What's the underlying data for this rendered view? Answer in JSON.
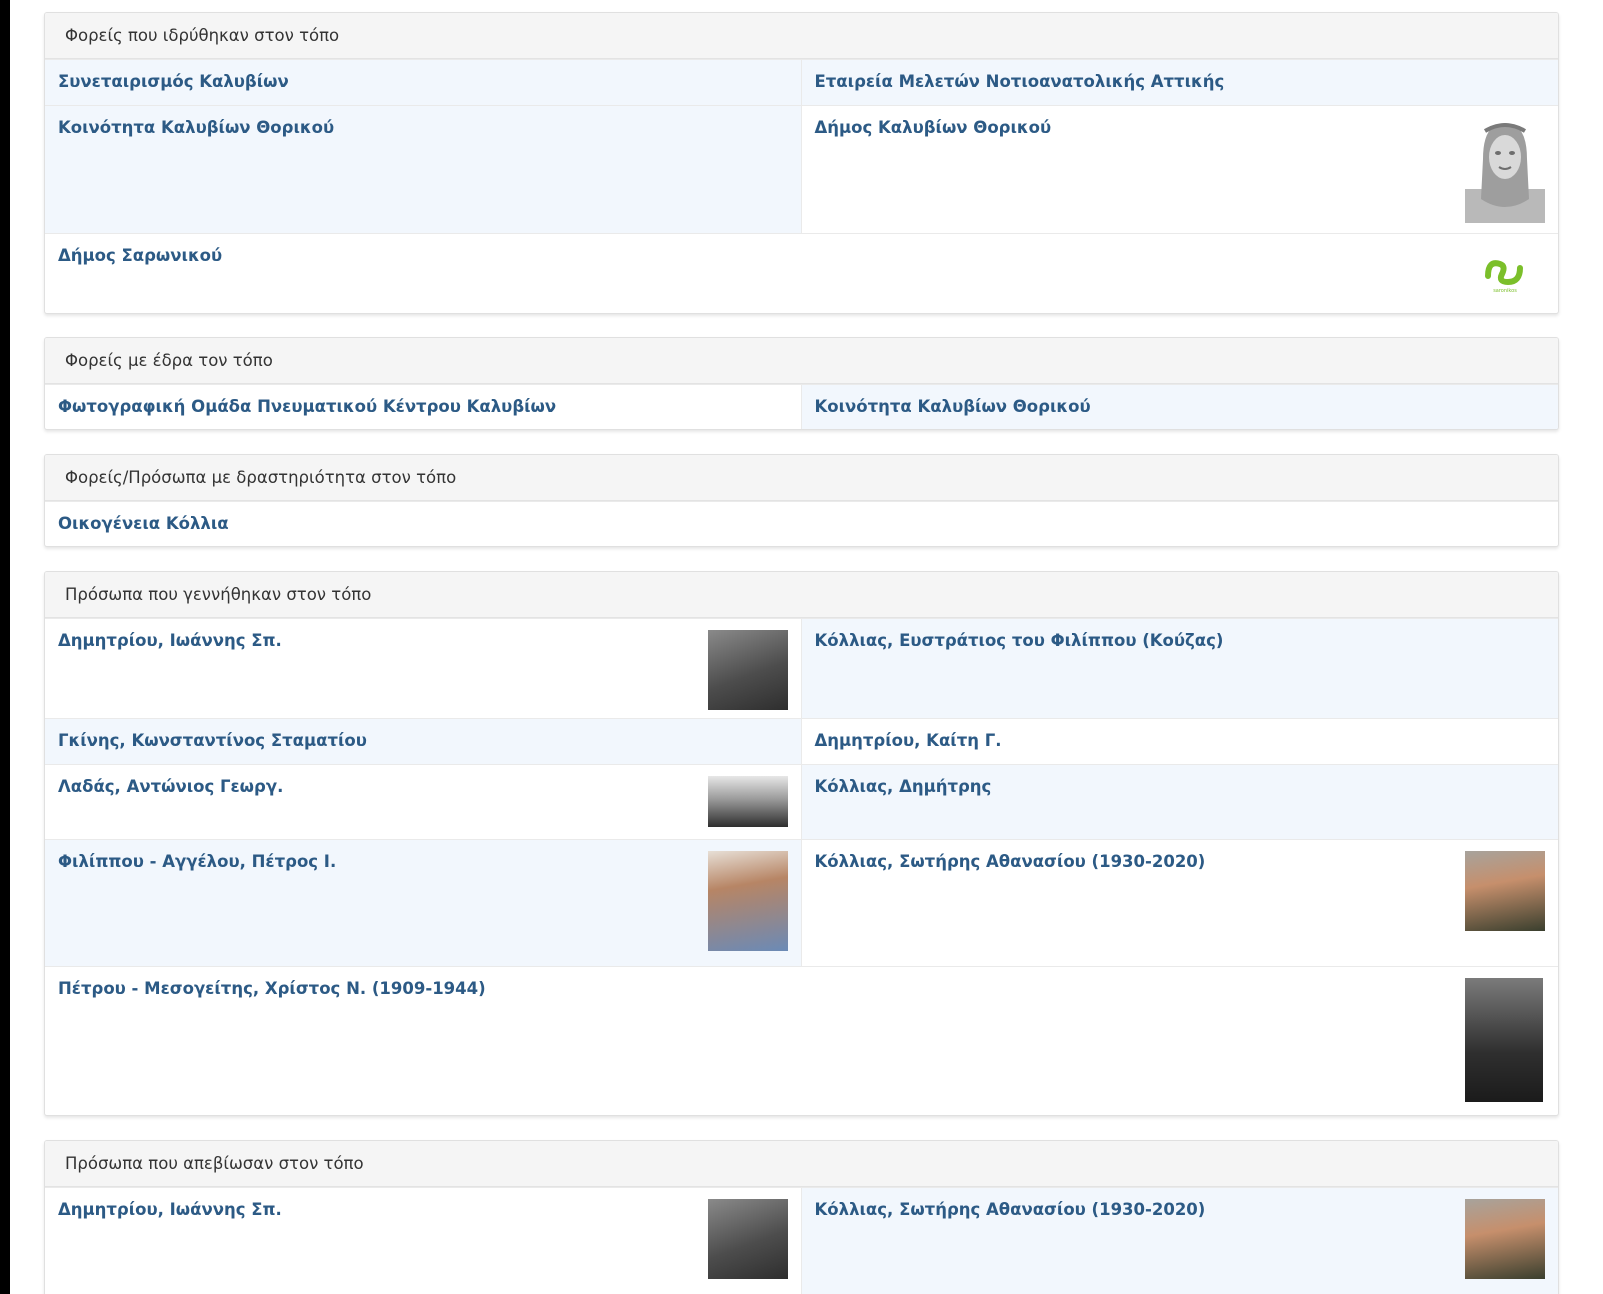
{
  "panels": [
    {
      "heading": "Φορείς που ιδρύθηκαν στον τόπο",
      "rows": [
        [
          "Συνεταιρισμός Καλυβίων",
          "Εταιρεία Μελετών Νοτιοανατολικής Αττικής"
        ],
        [
          "Κοινότητα Καλυβίων Θορικού",
          "Δήμος Καλυβίων Θορικού"
        ],
        [
          "Δήμος Σαρωνικού"
        ]
      ]
    },
    {
      "heading": "Φορείς με έδρα τον τόπο",
      "rows": [
        [
          "Φωτογραφική Ομάδα Πνευματικού Κέντρου Καλυβίων",
          "Κοινότητα Καλυβίων Θορικού"
        ]
      ]
    },
    {
      "heading": "Φορείς/Πρόσωπα με δραστηριότητα στον τόπο",
      "rows": [
        [
          "Οικογένεια Κόλλια"
        ]
      ]
    },
    {
      "heading": "Πρόσωπα που γεννήθηκαν στον τόπο",
      "rows": [
        [
          "Δημητρίου, Ιωάννης Σπ.",
          "Κόλλιας, Ευστράτιος του Φιλίππου (Κούζας)"
        ],
        [
          "Γκίνης, Κωνσταντίνος Σταματίου",
          "Δημητρίου, Καίτη Γ."
        ],
        [
          "Λαδάς, Αντώνιος Γεωργ.",
          "Κόλλιας, Δημήτρης"
        ],
        [
          "Φιλίππου - Αγγέλου, Πέτρος Ι.",
          "Κόλλιας, Σωτήρης Αθανασίου (1930-2020)"
        ],
        [
          "Πέτρου - Μεσογείτης, Χρίστος Ν. (1909-1944)"
        ]
      ]
    },
    {
      "heading": "Πρόσωπα που απεβίωσαν στον τόπο",
      "rows": [
        [
          "Δημητρίου, Ιωάννης Σπ.",
          "Κόλλιας, Σωτήρης Αθανασίου (1930-2020)"
        ]
      ]
    }
  ],
  "logo_text": "saronikos",
  "colors": {
    "link": "#2c5a85",
    "alt_row": "#f2f7fd",
    "heading_bg": "#f5f5f5",
    "logo_green": "#7bbf2a"
  }
}
